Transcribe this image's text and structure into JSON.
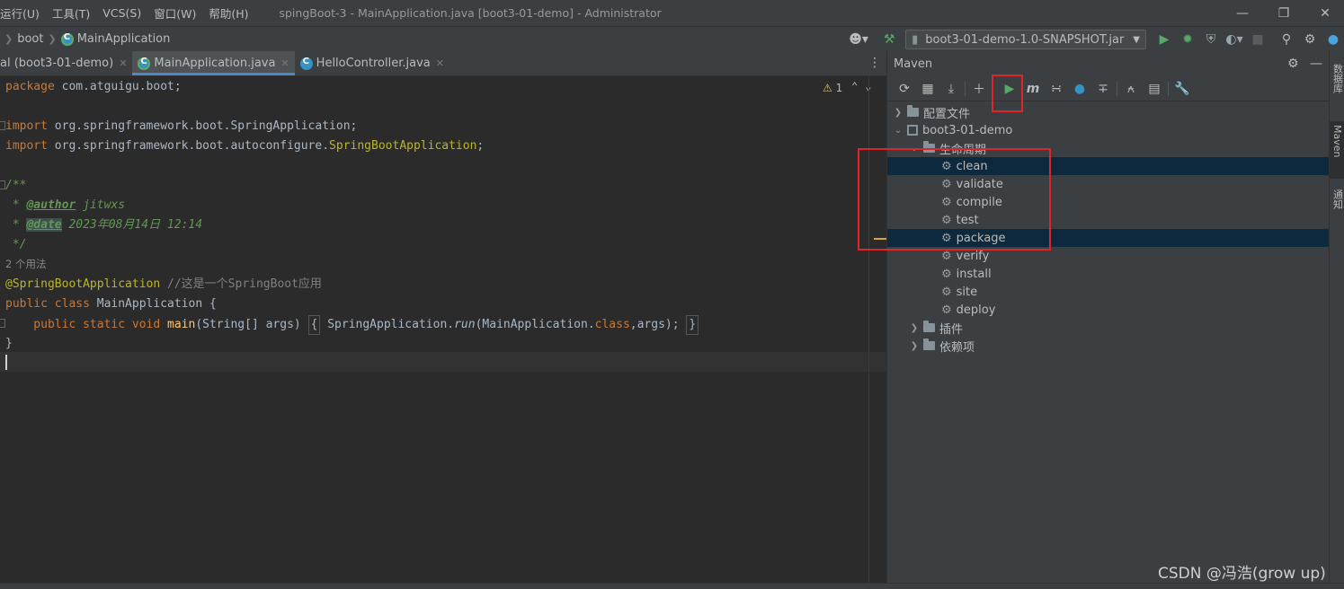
{
  "menubar": {
    "items": [
      "运行(U)",
      "工具(T)",
      "VCS(S)",
      "窗口(W)",
      "帮助(H)"
    ],
    "window_title": "spingBoot-3 - MainApplication.java [boot3-01-demo] - Administrator"
  },
  "navbar": {
    "crumbs": [
      "boot",
      "MainApplication"
    ],
    "run_config": "boot3-01-demo-1.0-SNAPSHOT.jar"
  },
  "tabs": [
    {
      "label": "al (boot3-01-demo)",
      "active": false
    },
    {
      "label": "MainApplication.java",
      "active": true
    },
    {
      "label": "HelloController.java",
      "active": false
    }
  ],
  "editor": {
    "warning_count": "1",
    "usages_hint": "2 个用法",
    "lines": {
      "pkg_kw": "package",
      "pkg_name": " com.atguigu.boot;",
      "imp1_kw": "import",
      "imp1_rest": " org.springframework.boot.SpringApplication;",
      "imp2_kw": "import",
      "imp2_mid": " org.springframework.boot.autoconfigure.",
      "imp2_ann": "SpringBootApplication",
      "imp2_end": ";",
      "doc_open": "/**",
      "doc_author_pre": " * ",
      "doc_author_tag": "@author",
      "doc_author_val": " jitwxs",
      "doc_date_pre": " * ",
      "doc_date_tag": "@date",
      "doc_date_val": " 2023年08月14日 12:14",
      "doc_close": " */",
      "ann": "@SpringBootApplication",
      "ann_comment": " //这是一个SpringBoot应用",
      "cls_kw": "public class",
      "cls_rest": " MainApplication {",
      "main_kw": "    public static void",
      "main_fn": " main",
      "main_args": "(String[] args) ",
      "main_body_open": "{",
      "main_body_mid": " SpringApplication.",
      "main_run": "run",
      "main_paren": "(MainApplication.",
      "main_class_kw": "class",
      "main_end": ",args);",
      "main_body_close": "}",
      "cls_close": "}"
    }
  },
  "maven": {
    "title": "Maven",
    "tree": {
      "profiles": "配置文件",
      "project": "boot3-01-demo",
      "lifecycle": "生命周期",
      "phases": [
        "clean",
        "validate",
        "compile",
        "test",
        "package",
        "verify",
        "install",
        "site",
        "deploy"
      ],
      "plugins": "插件",
      "dependencies": "依赖项"
    }
  },
  "right_stripe": {
    "tabs": [
      "数据库",
      "Maven",
      "通知"
    ]
  },
  "watermark": "CSDN @冯浩(grow up)",
  "colors": {
    "bg": "#2b2b2b",
    "panel": "#3c3f41",
    "selection": "#0d293e",
    "keyword": "#cc7832",
    "annotation": "#bbb529",
    "doc": "#629755",
    "highlight_box": "#e0252a",
    "run_green": "#59a869"
  }
}
